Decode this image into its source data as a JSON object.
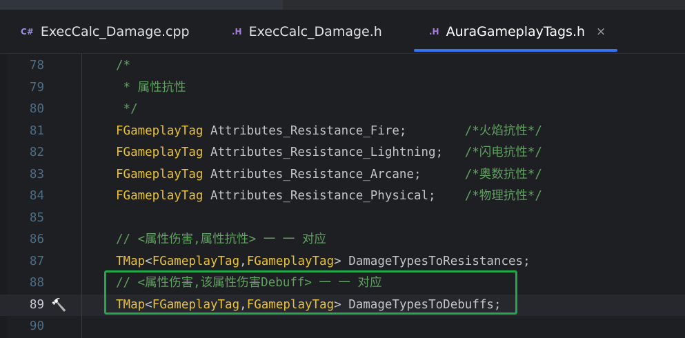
{
  "tabs": [
    {
      "icon": "C#",
      "label": "ExecCalc_Damage.cpp",
      "active": false
    },
    {
      "icon": ".H",
      "label": "ExecCalc_Damage.h",
      "active": false
    },
    {
      "icon": ".H",
      "label": "AuraGameplayTags.h",
      "active": true,
      "close": "×"
    }
  ],
  "colors": {
    "accent": "#3574f0",
    "highlight_box": "#22a84a",
    "comment": "#5fa160",
    "type": "#e8c23a"
  },
  "lines": [
    {
      "num": "78",
      "segments": [
        {
          "cls": "c-comment",
          "text": "/*"
        }
      ]
    },
    {
      "num": "79",
      "segments": [
        {
          "cls": "c-comment",
          "text": " * 属性抗性"
        }
      ]
    },
    {
      "num": "80",
      "segments": [
        {
          "cls": "c-comment",
          "text": " */"
        }
      ]
    },
    {
      "num": "81",
      "segments": [
        {
          "cls": "c-type",
          "text": "FGameplayTag"
        },
        {
          "cls": "c-ident",
          "text": " Attributes_Resistance_Fire;        "
        },
        {
          "cls": "c-comment",
          "text": "/*火焰抗性*/"
        }
      ]
    },
    {
      "num": "82",
      "segments": [
        {
          "cls": "c-type",
          "text": "FGameplayTag"
        },
        {
          "cls": "c-ident",
          "text": " Attributes_Resistance_Lightning;   "
        },
        {
          "cls": "c-comment",
          "text": "/*闪电抗性*/"
        }
      ]
    },
    {
      "num": "83",
      "segments": [
        {
          "cls": "c-type",
          "text": "FGameplayTag"
        },
        {
          "cls": "c-ident",
          "text": " Attributes_Resistance_Arcane;      "
        },
        {
          "cls": "c-comment",
          "text": "/*奥数抗性*/"
        }
      ]
    },
    {
      "num": "84",
      "segments": [
        {
          "cls": "c-type",
          "text": "FGameplayTag"
        },
        {
          "cls": "c-ident",
          "text": " Attributes_Resistance_Physical;    "
        },
        {
          "cls": "c-comment",
          "text": "/*物理抗性*/"
        }
      ]
    },
    {
      "num": "85",
      "segments": []
    },
    {
      "num": "86",
      "segments": [
        {
          "cls": "c-comment",
          "text": "// <属性伤害,属性抗性> 一 一 对应"
        }
      ]
    },
    {
      "num": "87",
      "segments": [
        {
          "cls": "c-tmap",
          "text": "TMap"
        },
        {
          "cls": "c-punct",
          "text": "<"
        },
        {
          "cls": "c-type",
          "text": "FGameplayTag"
        },
        {
          "cls": "c-punct",
          "text": ","
        },
        {
          "cls": "c-type",
          "text": "FGameplayTag"
        },
        {
          "cls": "c-punct",
          "text": "> "
        },
        {
          "cls": "c-ident",
          "text": "DamageTypesToResistances;"
        }
      ]
    },
    {
      "num": "88",
      "segments": [
        {
          "cls": "c-comment",
          "text": "// <属性伤害,该属性伤害Debuff> 一 一 对应"
        }
      ]
    },
    {
      "num": "89",
      "current": true,
      "gutter_icon": "hammer-icon",
      "segments": [
        {
          "cls": "c-tmap",
          "text": "TMap"
        },
        {
          "cls": "c-punct",
          "text": "<"
        },
        {
          "cls": "c-type",
          "text": "FGameplayTag"
        },
        {
          "cls": "c-punct",
          "text": ","
        },
        {
          "cls": "c-type",
          "text": "FGameplayTag"
        },
        {
          "cls": "c-punct",
          "text": "> "
        },
        {
          "cls": "c-ident",
          "text": "DamageTypesToDebuffs;"
        }
      ]
    },
    {
      "num": "90",
      "segments": []
    }
  ]
}
